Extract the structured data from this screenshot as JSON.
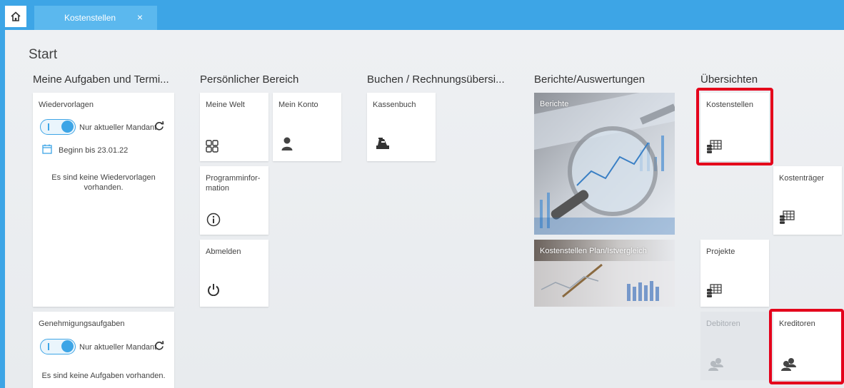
{
  "tabs": {
    "active_label": "Kostenstellen",
    "close_glyph": "×"
  },
  "page": {
    "title": "Start"
  },
  "columns": {
    "aufgaben": "Meine Aufgaben und Termi...",
    "persoenlich": "Persönlicher Bereich",
    "buchen": "Buchen / Rechnungsübersi...",
    "berichte": "Berichte/Auswertungen",
    "uebersichten": "Übersichten"
  },
  "wiedervorlagen": {
    "title": "Wiedervorlagen",
    "toggle_label": "Nur aktueller Mandant",
    "date_filter": "Beginn bis 23.01.22",
    "empty_line1": "Es sind keine Wiedervorlagen",
    "empty_line2": "vorhanden."
  },
  "genehmigung": {
    "title": "Genehmigungsaufgaben",
    "toggle_label": "Nur aktueller Mandant",
    "empty": "Es sind keine Aufgaben vorhanden."
  },
  "tiles": {
    "meine_welt": "Meine Welt",
    "mein_konto": "Mein Konto",
    "programminfo_line1": "Programminfor-",
    "programminfo_line2": "mation",
    "abmelden": "Abmelden",
    "kassenbuch": "Kassenbuch",
    "berichte": "Berichte",
    "plan_ist": "Kostenstellen Plan/Istvergleich",
    "kostenstellen": "Kostenstellen",
    "kostentraeger": "Kostenträger",
    "projekte": "Projekte",
    "debitoren": "Debitoren",
    "kreditoren": "Kreditoren"
  },
  "colors": {
    "accent": "#3da5e6",
    "highlight": "#e4001b"
  }
}
